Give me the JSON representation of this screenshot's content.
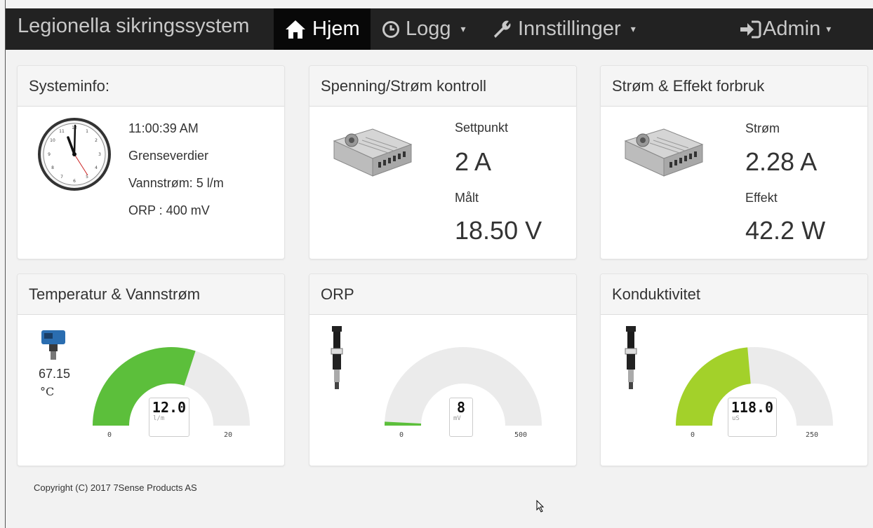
{
  "navbar": {
    "brand": "Legionella sikringssystem",
    "items": [
      {
        "label": "Hjem",
        "icon": "home-icon",
        "active": true
      },
      {
        "label": "Logg",
        "icon": "clock-icon",
        "dropdown": true
      },
      {
        "label": "Innstillinger",
        "icon": "wrench-icon",
        "dropdown": true
      },
      {
        "label": "Admin",
        "icon": "sign-in-icon",
        "dropdown": true
      }
    ]
  },
  "systeminfo": {
    "title": "Systeminfo:",
    "time": "11:00:39 AM",
    "limits_label": "Grenseverdier",
    "water_flow": "Vannstrøm: 5 l/m",
    "orp": "ORP : 400 mV"
  },
  "voltage_current": {
    "title": "Spenning/Strøm kontroll",
    "setpoint_label": "Settpunkt",
    "setpoint_value": "2 A",
    "measured_label": "Målt",
    "measured_value": "18.50 V"
  },
  "power": {
    "title": "Strøm & Effekt forbruk",
    "current_label": "Strøm",
    "current_value": "2.28 A",
    "effect_label": "Effekt",
    "effect_value": "42.2 W"
  },
  "temperature": {
    "title": "Temperatur & Vannstrøm",
    "temp_value": "67.15",
    "temp_unit": "°C",
    "gauge": {
      "value": "12.0",
      "unit": "l/m",
      "min": "0",
      "max": "20",
      "numeric": 12.0,
      "max_numeric": 20,
      "color": "#5cbf3b"
    }
  },
  "orp_panel": {
    "title": "ORP",
    "gauge": {
      "value": "8",
      "unit": "mV",
      "min": "0",
      "max": "500",
      "numeric": 8,
      "max_numeric": 500,
      "color": "#5cbf3b"
    }
  },
  "conductivity": {
    "title": "Konduktivitet",
    "gauge": {
      "value": "118.0",
      "unit": "uS",
      "min": "0",
      "max": "250",
      "numeric": 118.0,
      "max_numeric": 250,
      "color": "#a3d12a"
    }
  },
  "footer": {
    "copyright": "Copyright (C) 2017 7Sense Products AS"
  }
}
